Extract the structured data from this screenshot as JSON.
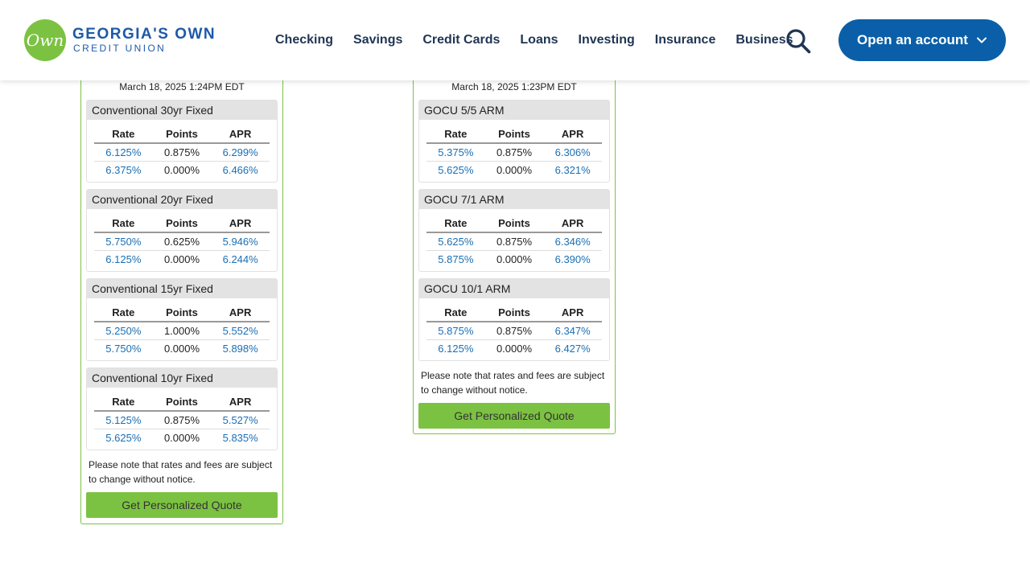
{
  "header": {
    "logo_mark": "Own",
    "logo_main": "GEORGIA'S OWN",
    "logo_sub": "CREDIT UNION",
    "nav": [
      "Checking",
      "Savings",
      "Credit Cards",
      "Loans",
      "Investing",
      "Insurance",
      "Business"
    ],
    "open_account_label": "Open an account",
    "brand_blue": "#0a5fa8",
    "brand_green": "#7cc242"
  },
  "left_panel": {
    "timestamp": "March 18, 2025 1:24PM EDT",
    "columns": [
      "Rate",
      "Points",
      "APR"
    ],
    "products": [
      {
        "title": "Conventional 30yr Fixed",
        "rows": [
          [
            "6.125%",
            "0.875%",
            "6.299%"
          ],
          [
            "6.375%",
            "0.000%",
            "6.466%"
          ]
        ]
      },
      {
        "title": "Conventional 20yr Fixed",
        "rows": [
          [
            "5.750%",
            "0.625%",
            "5.946%"
          ],
          [
            "6.125%",
            "0.000%",
            "6.244%"
          ]
        ]
      },
      {
        "title": "Conventional 15yr Fixed",
        "rows": [
          [
            "5.250%",
            "1.000%",
            "5.552%"
          ],
          [
            "5.750%",
            "0.000%",
            "5.898%"
          ]
        ]
      },
      {
        "title": "Conventional 10yr Fixed",
        "rows": [
          [
            "5.125%",
            "0.875%",
            "5.527%"
          ],
          [
            "5.625%",
            "0.000%",
            "5.835%"
          ]
        ]
      }
    ],
    "note": "Please note that rates and fees are subject to change without notice.",
    "quote_label": "Get Personalized Quote"
  },
  "right_panel": {
    "timestamp": "March 18, 2025 1:23PM EDT",
    "columns": [
      "Rate",
      "Points",
      "APR"
    ],
    "products": [
      {
        "title": "GOCU 5/5 ARM",
        "rows": [
          [
            "5.375%",
            "0.875%",
            "6.306%"
          ],
          [
            "5.625%",
            "0.000%",
            "6.321%"
          ]
        ]
      },
      {
        "title": "GOCU 7/1 ARM",
        "rows": [
          [
            "5.625%",
            "0.875%",
            "6.346%"
          ],
          [
            "5.875%",
            "0.000%",
            "6.390%"
          ]
        ]
      },
      {
        "title": "GOCU 10/1 ARM",
        "rows": [
          [
            "5.875%",
            "0.875%",
            "6.347%"
          ],
          [
            "6.125%",
            "0.000%",
            "6.427%"
          ]
        ]
      }
    ],
    "note": "Please note that rates and fees are subject to change without notice.",
    "quote_label": "Get Personalized Quote"
  }
}
